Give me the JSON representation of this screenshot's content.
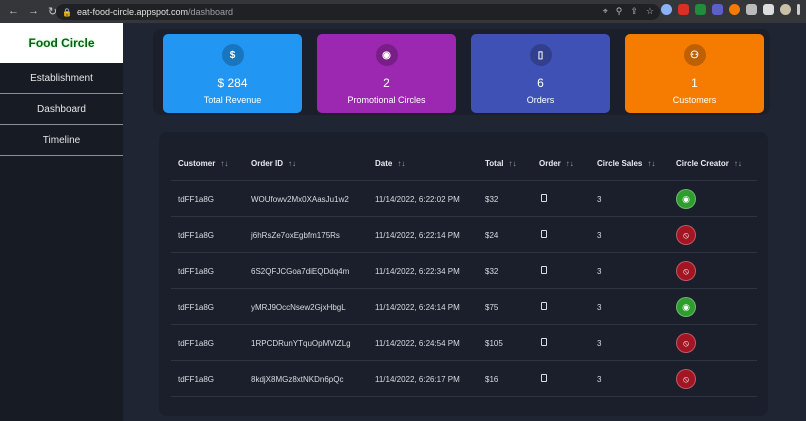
{
  "browser": {
    "url_host": "eat-food-circle.appspot.com",
    "url_path": "/dashboard"
  },
  "sidebar": {
    "brand": "Food Circle",
    "items": [
      {
        "label": "Establishment"
      },
      {
        "label": "Dashboard"
      },
      {
        "label": "Timeline"
      }
    ]
  },
  "stats": [
    {
      "icon": "dollar-icon",
      "glyph": "$",
      "value": "$ 284",
      "label": "Total Revenue",
      "color": "#2196f3"
    },
    {
      "icon": "map-pin-icon",
      "glyph": "◉",
      "value": "2",
      "label": "Promotional Circles",
      "color": "#9c27b0"
    },
    {
      "icon": "file-icon",
      "glyph": "▯",
      "value": "6",
      "label": "Orders",
      "color": "#3f51b5"
    },
    {
      "icon": "users-icon",
      "glyph": "⚇",
      "value": "1",
      "label": "Customers",
      "color": "#f57c00"
    }
  ],
  "table": {
    "columns": [
      "Customer",
      "Order ID",
      "Date",
      "Total",
      "Order",
      "Circle Sales",
      "Circle Creator"
    ],
    "rows": [
      {
        "customer": "tdFF1a8G",
        "order_id": "WOUfowv2Mx0XAasJu1w2",
        "date": "11/14/2022, 6:22:02 PM",
        "total": "$32",
        "circle_sales": "3",
        "creator": true
      },
      {
        "customer": "tdFF1a8G",
        "order_id": "j6hRsZe7oxEgbfm175Rs",
        "date": "11/14/2022, 6:22:14 PM",
        "total": "$24",
        "circle_sales": "3",
        "creator": false
      },
      {
        "customer": "tdFF1a8G",
        "order_id": "6S2QFJCGoa7diEQDdq4m",
        "date": "11/14/2022, 6:22:34 PM",
        "total": "$32",
        "circle_sales": "3",
        "creator": false
      },
      {
        "customer": "tdFF1a8G",
        "order_id": "yMRJ9OccNsew2GjxHbgL",
        "date": "11/14/2022, 6:24:14 PM",
        "total": "$75",
        "circle_sales": "3",
        "creator": true
      },
      {
        "customer": "tdFF1a8G",
        "order_id": "1RPCDRunYTquOpMVtZLg",
        "date": "11/14/2022, 6:24:54 PM",
        "total": "$105",
        "circle_sales": "3",
        "creator": false
      },
      {
        "customer": "tdFF1a8G",
        "order_id": "8kdjX8MGz8xtNKDn6pQc",
        "date": "11/14/2022, 6:26:17 PM",
        "total": "$16",
        "circle_sales": "3",
        "creator": false
      }
    ]
  }
}
